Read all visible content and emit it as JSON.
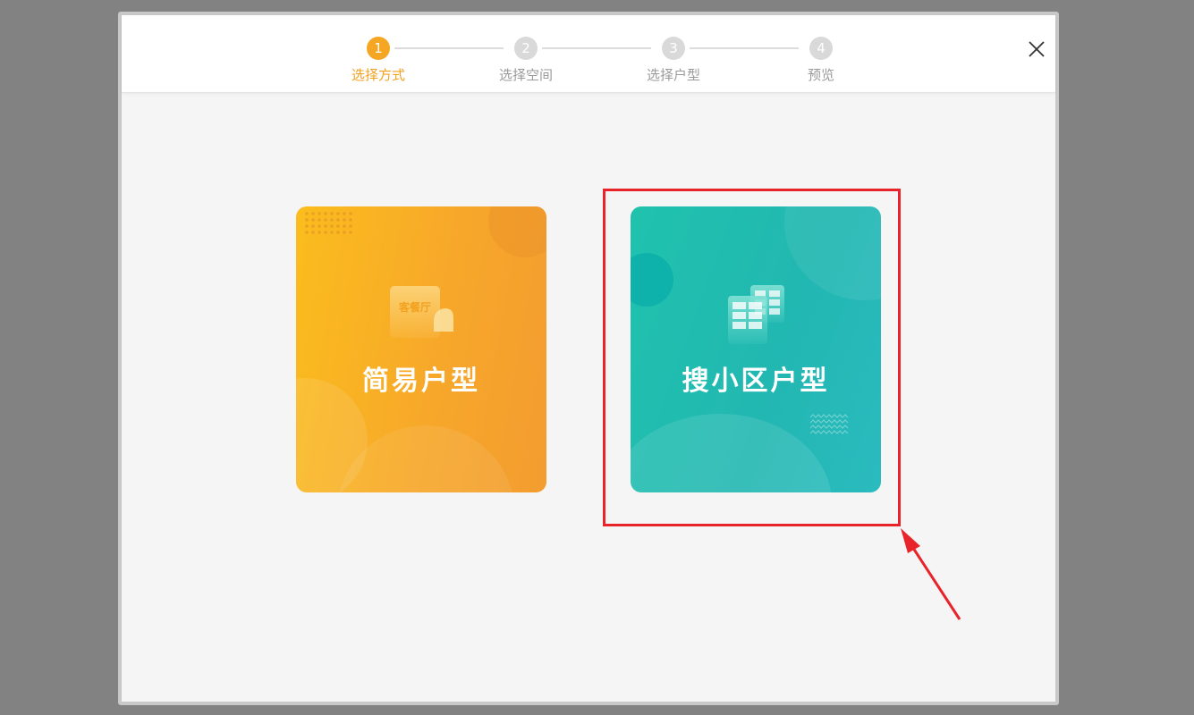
{
  "wizard": {
    "steps": [
      {
        "number": "1",
        "label": "选择方式",
        "active": true
      },
      {
        "number": "2",
        "label": "选择空间",
        "active": false
      },
      {
        "number": "3",
        "label": "选择户型",
        "active": false
      },
      {
        "number": "4",
        "label": "预览",
        "active": false
      }
    ],
    "active_color": "#f5a623",
    "inactive_color": "#d9d9d9",
    "close_icon": "close-icon"
  },
  "options": {
    "simple": {
      "title": "简易户型",
      "badge_text": "客餐厅",
      "color": "#f7a82a"
    },
    "community": {
      "title": "搜小区户型",
      "color": "#22b7b2"
    }
  },
  "annotation": {
    "highlight_color": "#e8232a"
  }
}
